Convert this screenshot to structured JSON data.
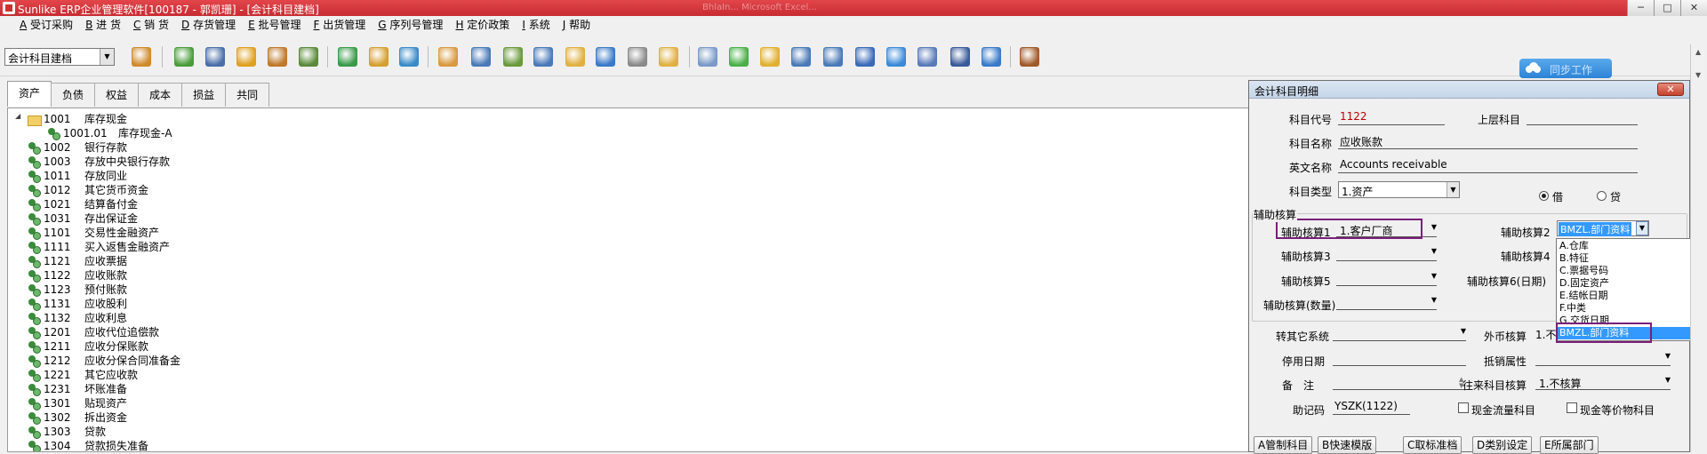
{
  "window": {
    "title": "Sunlike ERP企业管理软件[100187 - 郭凯珊] - [会计科目建档]",
    "blurred_text": "BhlaIn... Microsoft Excel...",
    "controls": [
      "─",
      "□",
      "✕"
    ]
  },
  "menu": [
    {
      "key": "A",
      "label": "受订采购"
    },
    {
      "key": "B",
      "label": "进 货"
    },
    {
      "key": "C",
      "label": "销 货"
    },
    {
      "key": "D",
      "label": "存货管理"
    },
    {
      "key": "E",
      "label": "批号管理"
    },
    {
      "key": "F",
      "label": "出货管理"
    },
    {
      "key": "G",
      "label": "序列号管理"
    },
    {
      "key": "H",
      "label": "定价政策"
    },
    {
      "key": "I",
      "label": "系统"
    },
    {
      "key": "J",
      "label": "帮助"
    }
  ],
  "toolbar": {
    "module_select": "会计科目建档",
    "icons": [
      {
        "name": "abc-icon",
        "color": "#d08a2a"
      },
      {
        "name": "phone-icon",
        "color": "#4a9d3a"
      },
      {
        "name": "computer-icon",
        "color": "#4a6fa8"
      },
      {
        "name": "lock-icon",
        "color": "#e0a020"
      },
      {
        "name": "briefcase-icon",
        "color": "#c0782a"
      },
      {
        "name": "home-icon",
        "color": "#5a8a3a"
      },
      {
        "name": "dollar-icon",
        "color": "#3a9a4a"
      },
      {
        "name": "moneybag-icon",
        "color": "#d4a030"
      },
      {
        "name": "cart-icon",
        "color": "#3a8ac8"
      },
      {
        "name": "clipboard-icon",
        "color": "#d89a40"
      },
      {
        "name": "users-icon",
        "color": "#4a7ab8"
      },
      {
        "name": "transfer-icon",
        "color": "#6a9a3a"
      },
      {
        "name": "help-doc-icon",
        "color": "#4a7ab8"
      },
      {
        "name": "mail-icon",
        "color": "#e0b040"
      },
      {
        "name": "info-icon",
        "color": "#3a7ac8"
      },
      {
        "name": "calculator-icon",
        "color": "#8a8a8a"
      },
      {
        "name": "folder-icon",
        "color": "#e0b040"
      },
      {
        "name": "copy-icon",
        "color": "#7a9ac8"
      },
      {
        "name": "check-icon",
        "color": "#4ab04a"
      },
      {
        "name": "bell-icon",
        "color": "#e0b030"
      },
      {
        "name": "search-icon",
        "color": "#4a7ab8"
      },
      {
        "name": "org-chart-icon",
        "color": "#4a7ab8"
      },
      {
        "name": "monitor-icon",
        "color": "#3a6ab8"
      },
      {
        "name": "refresh-icon",
        "color": "#3a8ad8"
      },
      {
        "name": "windows-icon",
        "color": "#5a7ab8"
      },
      {
        "name": "close-x-icon",
        "color": "#3a5a9a"
      },
      {
        "name": "window-tile-icon",
        "color": "#3a7ac8"
      },
      {
        "name": "exit-door-icon",
        "color": "#a05a2a"
      }
    ],
    "cloud_button": "同步工作"
  },
  "tabs": [
    "资产",
    "负债",
    "权益",
    "成本",
    "损益",
    "共同"
  ],
  "tree": [
    {
      "code": "1001",
      "name": "库存现金",
      "level": 0,
      "type": "folder"
    },
    {
      "code": "1001.01",
      "name": "库存现金-A",
      "level": 1,
      "type": "leaf"
    },
    {
      "code": "1002",
      "name": "银行存款",
      "level": 0,
      "type": "leaf"
    },
    {
      "code": "1003",
      "name": "存放中央银行存款",
      "level": 0,
      "type": "leaf"
    },
    {
      "code": "1011",
      "name": "存放同业",
      "level": 0,
      "type": "leaf"
    },
    {
      "code": "1012",
      "name": "其它货币资金",
      "level": 0,
      "type": "leaf"
    },
    {
      "code": "1021",
      "name": "结算备付金",
      "level": 0,
      "type": "leaf"
    },
    {
      "code": "1031",
      "name": "存出保证金",
      "level": 0,
      "type": "leaf"
    },
    {
      "code": "1101",
      "name": "交易性金融资产",
      "level": 0,
      "type": "leaf"
    },
    {
      "code": "1111",
      "name": "买入返售金融资产",
      "level": 0,
      "type": "leaf"
    },
    {
      "code": "1121",
      "name": "应收票据",
      "level": 0,
      "type": "leaf"
    },
    {
      "code": "1122",
      "name": "应收账款",
      "level": 0,
      "type": "leaf"
    },
    {
      "code": "1123",
      "name": "预付账款",
      "level": 0,
      "type": "leaf"
    },
    {
      "code": "1131",
      "name": "应收股利",
      "level": 0,
      "type": "leaf"
    },
    {
      "code": "1132",
      "name": "应收利息",
      "level": 0,
      "type": "leaf"
    },
    {
      "code": "1201",
      "name": "应收代位追偿款",
      "level": 0,
      "type": "leaf"
    },
    {
      "code": "1211",
      "name": "应收分保账款",
      "level": 0,
      "type": "leaf"
    },
    {
      "code": "1212",
      "name": "应收分保合同准备金",
      "level": 0,
      "type": "leaf"
    },
    {
      "code": "1221",
      "name": "其它应收款",
      "level": 0,
      "type": "leaf"
    },
    {
      "code": "1231",
      "name": "坏账准备",
      "level": 0,
      "type": "leaf"
    },
    {
      "code": "1301",
      "name": "贴现资产",
      "level": 0,
      "type": "leaf"
    },
    {
      "code": "1302",
      "name": "拆出资金",
      "level": 0,
      "type": "leaf"
    },
    {
      "code": "1303",
      "name": "贷款",
      "level": 0,
      "type": "leaf"
    },
    {
      "code": "1304",
      "name": "贷款损失准备",
      "level": 0,
      "type": "leaf"
    }
  ],
  "dialog": {
    "title": "会计科目明细",
    "close": "✕",
    "code_label": "科目代号",
    "code_value": "1122",
    "parent_label": "上层科目",
    "parent_value": "",
    "name_label": "科目名称",
    "name_value": "应收账款",
    "en_label": "英文名称",
    "en_value": "Accounts receivable",
    "type_label": "科目类型",
    "type_value": "1.资产",
    "debit_label": "借",
    "credit_label": "贷",
    "aux_group": "辅助核算",
    "aux1_label": "辅助核算1",
    "aux1_value": "1.客户厂商",
    "aux2_label": "辅助核算2",
    "aux2_value": "BMZL.部门资料",
    "aux3_label": "辅助核算3",
    "aux4_label": "辅助核算4",
    "aux5_label": "辅助核算5",
    "aux6_label": "辅助核算6(日期)",
    "auxqty_label": "辅助核算(数量)",
    "transfer_label": "转其它系统",
    "foreign_label": "外币核算",
    "foreign_value": "1.不",
    "disable_label": "停用日期",
    "offset_label": "抵销属性",
    "note_label": "备　注",
    "dealing_label": "往来科目核算",
    "dealing_value": "1.不核算",
    "mnemonic_label": "助记码",
    "mnemonic_value": "YSZK(1122)",
    "cashflow_label": "现金流量科目",
    "cashequiv_label": "现金等价物科目",
    "buttons": [
      "A管制科目",
      "B快速模版",
      "C取标准档",
      "D类别设定",
      "E所属部门"
    ]
  },
  "aux2_options": [
    "A.仓库",
    "B.特征",
    "C.票据号码",
    "D.固定资产",
    "E.结帐日期",
    "F.中类",
    "G.交货日期",
    "BMZL.部门资料"
  ],
  "colors": {
    "titlebar": "#d0353a",
    "highlight_box": "#7a1f7a",
    "selection": "#3399ff",
    "code_red": "#c00000"
  }
}
